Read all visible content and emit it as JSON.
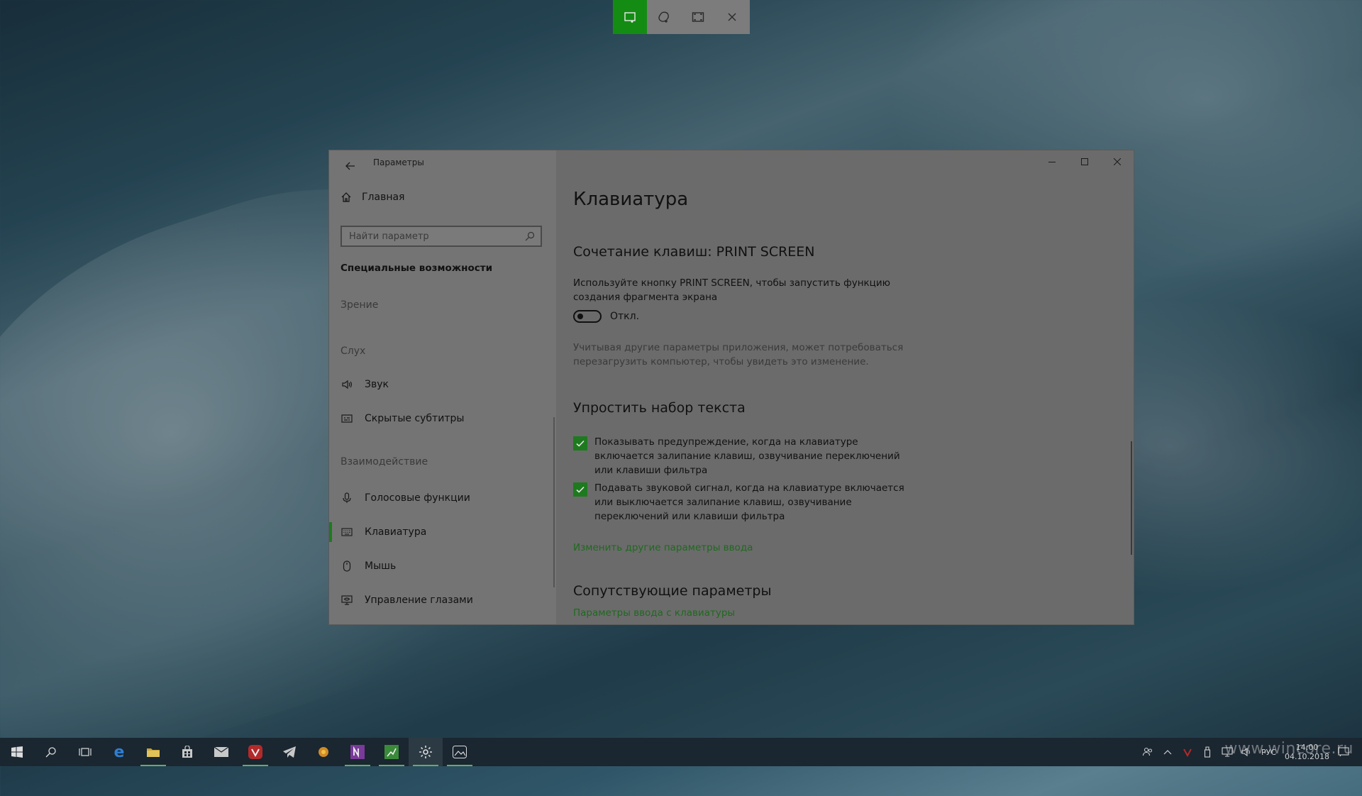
{
  "snip_toolbar": {
    "tools": [
      {
        "name": "rectangular-snip",
        "active": true
      },
      {
        "name": "freeform-snip",
        "active": false
      },
      {
        "name": "fullscreen-snip",
        "active": false
      },
      {
        "name": "close",
        "active": false
      }
    ],
    "accent": "#148c14"
  },
  "window": {
    "title": "Параметры",
    "controls": [
      "minimize",
      "maximize",
      "close"
    ]
  },
  "sidebar": {
    "home_label": "Главная",
    "search_placeholder": "Найти параметр",
    "section_heading": "Специальные возможности",
    "groups": {
      "vision": "Зрение",
      "hearing": "Слух",
      "interaction": "Взаимодействие"
    },
    "items": [
      {
        "label": "Звук",
        "icon": "speaker-icon"
      },
      {
        "label": "Скрытые субтитры",
        "icon": "captions-icon"
      },
      {
        "label": "Голосовые функции",
        "icon": "microphone-icon"
      },
      {
        "label": "Клавиатура",
        "icon": "keyboard-icon",
        "active": true
      },
      {
        "label": "Мышь",
        "icon": "mouse-icon"
      },
      {
        "label": "Управление глазами",
        "icon": "eye-control-icon"
      }
    ]
  },
  "main": {
    "page_title": "Клавиатура",
    "print_screen": {
      "heading": "Сочетание клавиш: PRINT SCREEN",
      "description": "Используйте кнопку PRINT SCREEN, чтобы запустить функцию создания фрагмента экрана",
      "toggle_state": "Откл.",
      "toggle_on": false,
      "note": "Учитывая другие параметры приложения, может потребоваться перезагрузить компьютер, чтобы увидеть это изменение."
    },
    "simplify_typing": {
      "heading": "Упростить набор текста",
      "options": [
        {
          "label": "Показывать предупреждение, когда на клавиатуре включается залипание клавиш, озвучивание переключений или клавиши фильтра",
          "checked": true
        },
        {
          "label": "Подавать звуковой сигнал, когда на клавиатуре включается или выключается залипание клавиш, озвучивание переключений или клавиши фильтра",
          "checked": true
        }
      ],
      "link": "Изменить другие параметры ввода"
    },
    "related": {
      "heading": "Сопутствующие параметры",
      "link": "Параметры ввода с клавиатуры"
    }
  },
  "taskbar": {
    "apps": [
      "start",
      "search",
      "task-view",
      "edge",
      "file-explorer",
      "store",
      "mail",
      "vivaldi",
      "telegram",
      "game",
      "onenote",
      "sheets",
      "settings",
      "photos"
    ],
    "tray": {
      "language": "РУС",
      "time": "14:00",
      "date": "04.10.2018"
    }
  },
  "watermark": "www.wincore.ru",
  "colors": {
    "accent_green": "#1e7a1e",
    "link_green": "#1e6a1e"
  }
}
